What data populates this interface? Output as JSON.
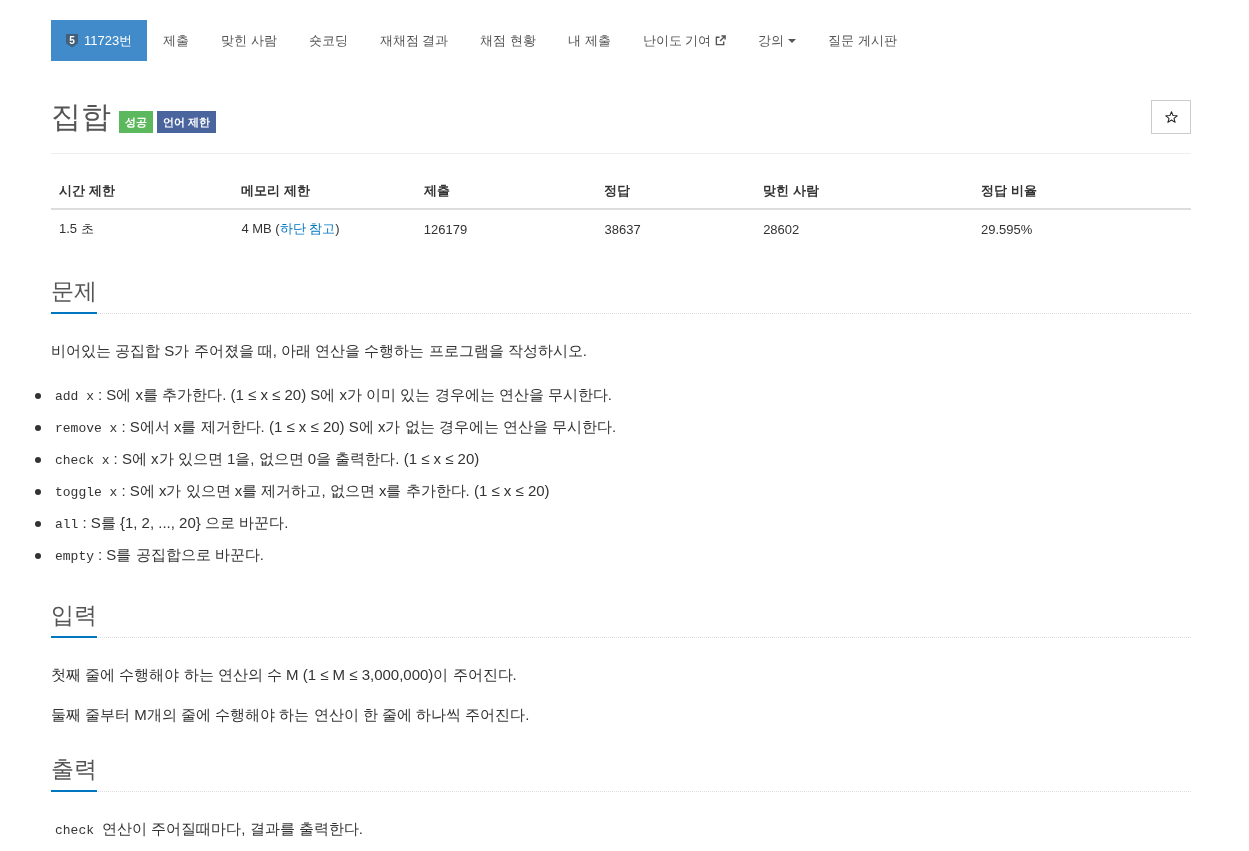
{
  "nav": {
    "tabs": [
      {
        "label": "11723번",
        "kind": "problem",
        "badge": "5",
        "selected": true
      },
      {
        "label": "제출",
        "kind": "link",
        "selected": false
      },
      {
        "label": "맞힌 사람",
        "kind": "link",
        "selected": false
      },
      {
        "label": "숏코딩",
        "kind": "link",
        "selected": false
      },
      {
        "label": "재채점 결과",
        "kind": "link",
        "selected": false
      },
      {
        "label": "채점 현황",
        "kind": "link",
        "selected": false
      },
      {
        "label": "내 제출",
        "kind": "link",
        "selected": false
      },
      {
        "label": "난이도 기여",
        "kind": "external",
        "selected": false
      },
      {
        "label": "강의",
        "kind": "dropdown",
        "selected": false
      },
      {
        "label": "질문 게시판",
        "kind": "link",
        "selected": false
      }
    ]
  },
  "problem": {
    "title": "집합",
    "labels": [
      {
        "text": "성공",
        "color": "#5cb85c"
      },
      {
        "text": "언어 제한",
        "color": "#4a649e"
      }
    ]
  },
  "table": {
    "columns": [
      "시간 제한",
      "메모리 제한",
      "제출",
      "정답",
      "맞힌 사람",
      "정답 비율"
    ],
    "rows": [
      [
        "1.5 초",
        {
          "text": "4 MB (",
          "link": "하단 참고",
          "after": ")"
        },
        "126179",
        "38637",
        "28602",
        "29.595%"
      ]
    ]
  },
  "sections": [
    {
      "heading": "문제",
      "blocks": [
        {
          "kind": "paragraph",
          "text": "비어있는 공집합 S가 주어졌을 때, 아래 연산을 수행하는 프로그램을 작성하시오."
        },
        {
          "kind": "list",
          "items": [
            {
              "code": "add x",
              "text": ": S에 x를 추가한다. (1 ≤ x ≤ 20) S에 x가 이미 있는 경우에는 연산을 무시한다."
            },
            {
              "code": "remove x",
              "text": ": S에서 x를 제거한다. (1 ≤ x ≤ 20) S에 x가 없는 경우에는 연산을 무시한다."
            },
            {
              "code": "check x",
              "text": ": S에 x가 있으면 1을, 없으면 0을 출력한다. (1 ≤ x ≤ 20)"
            },
            {
              "code": "toggle x",
              "text": ": S에 x가 있으면 x를 제거하고, 없으면 x를 추가한다. (1 ≤ x ≤ 20)"
            },
            {
              "code": "all",
              "text": ": S를 {1, 2, ..., 20} 으로 바꾼다."
            },
            {
              "code": "empty",
              "text": ": S를 공집합으로 바꾼다."
            }
          ]
        }
      ]
    },
    {
      "heading": "입력",
      "blocks": [
        {
          "kind": "paragraph",
          "text": "첫째 줄에 수행해야 하는 연산의 수 M (1 ≤ M ≤ 3,000,000)이 주어진다."
        },
        {
          "kind": "paragraph",
          "text": "둘째 줄부터 M개의 줄에 수행해야 하는 연산이 한 줄에 하나씩 주어진다."
        }
      ]
    },
    {
      "heading": "출력",
      "blocks": [
        {
          "kind": "paragraph",
          "code": "check",
          "text": "연산이 주어질때마다, 결과를 출력한다."
        }
      ]
    }
  ]
}
